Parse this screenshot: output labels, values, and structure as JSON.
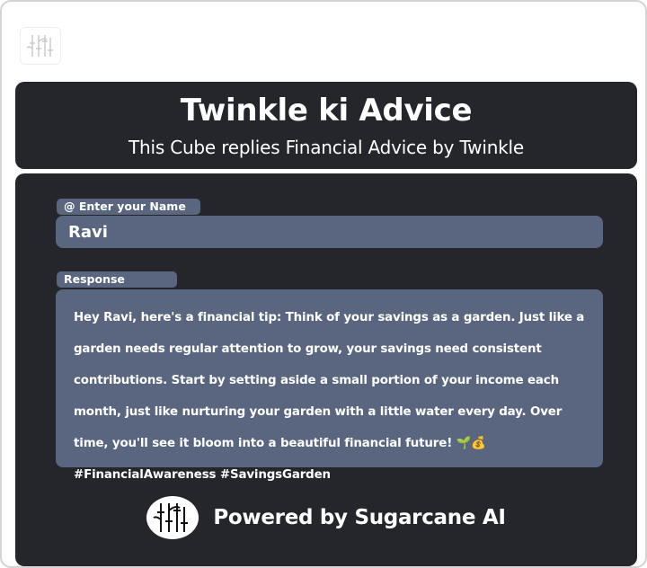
{
  "header": {
    "title": "Twinkle ki Advice",
    "subtitle": "This Cube replies Financial Advice by Twinkle"
  },
  "name_field": {
    "label": "@ Enter your Name",
    "value": "Ravi"
  },
  "response_field": {
    "label": "Response",
    "text": "Hey Ravi, here's a financial tip: Think of your savings as a garden. Just like a garden needs regular attention to grow, your savings need consistent contributions. Start by setting aside a small portion of your income each month, just like nurturing your garden with a little water every day. Over time, you'll see it bloom into a beautiful financial future! 🌱💰 #FinancialAwareness #SavingsGarden"
  },
  "footer": {
    "powered_by": "Powered by Sugarcane AI",
    "logo_icon": "bamboo-logo-icon"
  },
  "colors": {
    "panel_bg": "#25262b",
    "field_bg": "#5a6680",
    "text": "#ffffff"
  }
}
